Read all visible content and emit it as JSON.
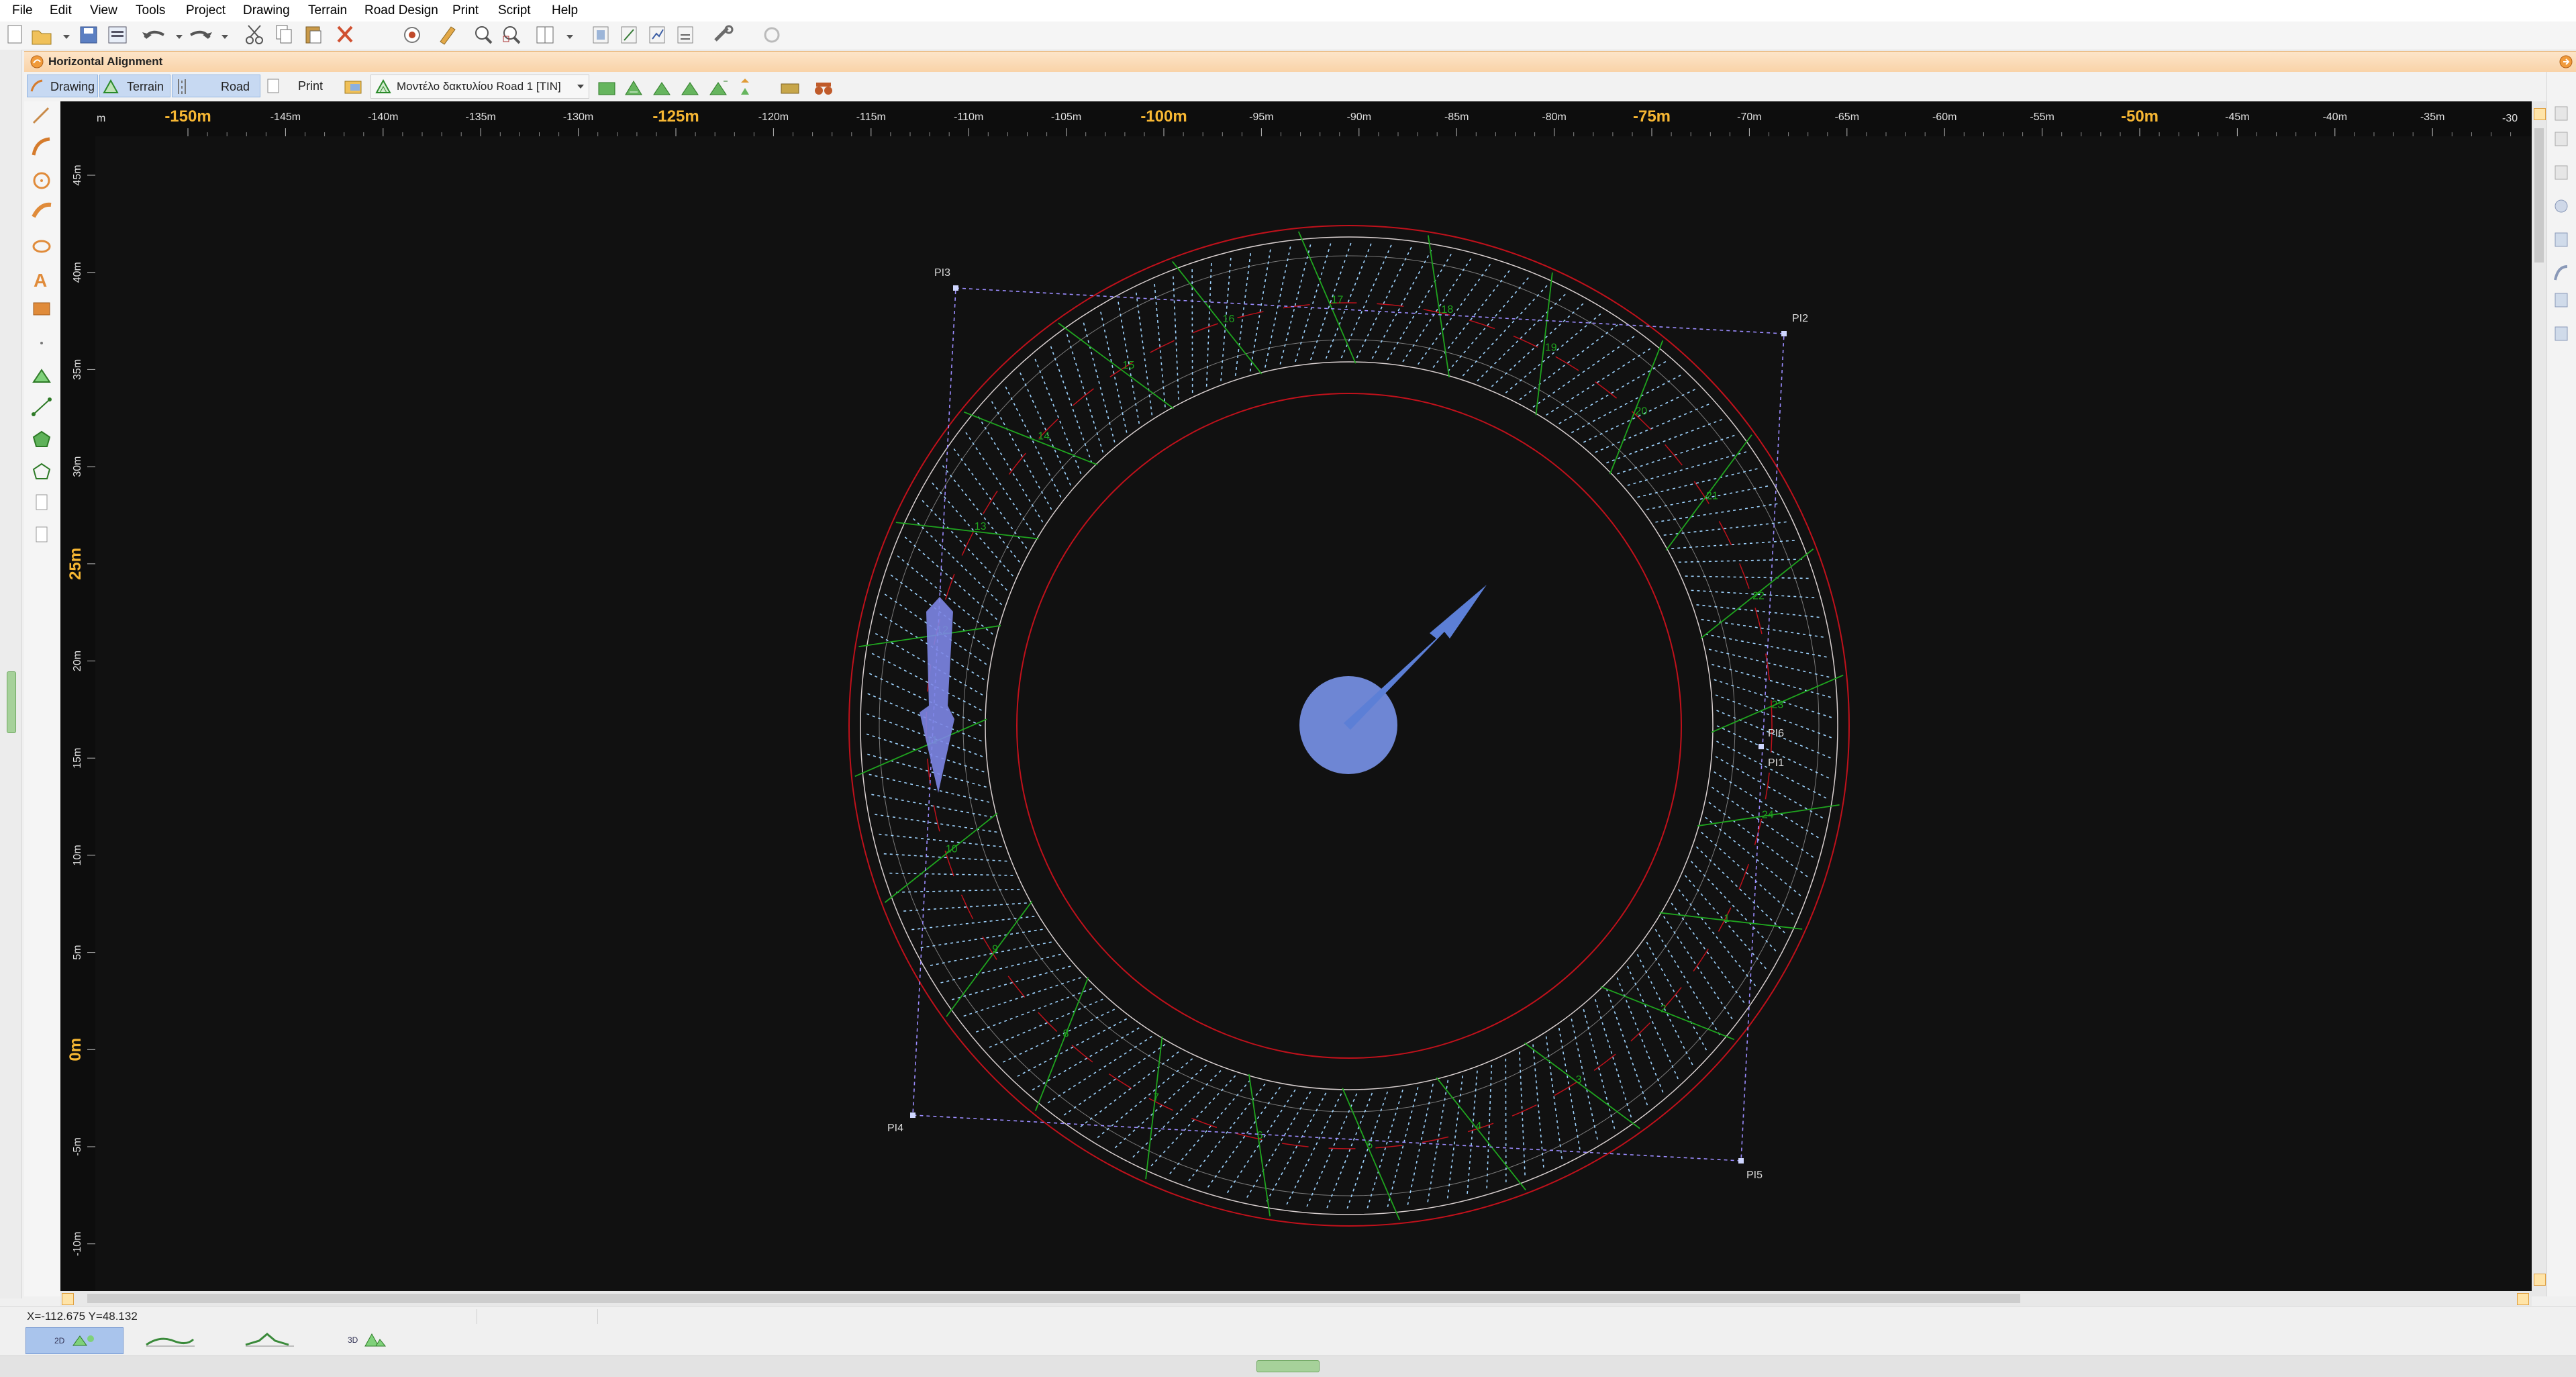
{
  "menu": {
    "items": [
      "File",
      "Edit",
      "View",
      "Tools",
      "Project",
      "Drawing",
      "Terrain",
      "Road Design",
      "Print",
      "Script",
      "Help"
    ]
  },
  "panel": {
    "title": "Horizontal Alignment"
  },
  "view_tabs": {
    "drawing": "Drawing",
    "terrain": "Terrain",
    "road": "Road",
    "print": "Print",
    "model_select": "Μοντέλο δακτυλίου Road 1 [TIN]"
  },
  "ruler": {
    "x_labels": [
      {
        "text": "-150m",
        "major": true
      },
      {
        "text": "-145m",
        "major": false
      },
      {
        "text": "-140m",
        "major": false
      },
      {
        "text": "-135m",
        "major": false
      },
      {
        "text": "-130m",
        "major": false
      },
      {
        "text": "-125m",
        "major": true
      },
      {
        "text": "-120m",
        "major": false
      },
      {
        "text": "-115m",
        "major": false
      },
      {
        "text": "-110m",
        "major": false
      },
      {
        "text": "-105m",
        "major": false
      },
      {
        "text": "-100m",
        "major": true
      },
      {
        "text": "-95m",
        "major": false
      },
      {
        "text": "-90m",
        "major": false
      },
      {
        "text": "-85m",
        "major": false
      },
      {
        "text": "-80m",
        "major": false
      },
      {
        "text": "-75m",
        "major": true
      },
      {
        "text": "-70m",
        "major": false
      },
      {
        "text": "-65m",
        "major": false
      },
      {
        "text": "-60m",
        "major": false
      },
      {
        "text": "-55m",
        "major": false
      },
      {
        "text": "-50m",
        "major": true
      },
      {
        "text": "-45m",
        "major": false
      },
      {
        "text": "-40m",
        "major": false
      },
      {
        "text": "-35m",
        "major": false
      }
    ],
    "x_edge_left": "m",
    "x_edge_right": "-30",
    "y_labels": [
      {
        "text": "45m",
        "major": false
      },
      {
        "text": "40m",
        "major": false
      },
      {
        "text": "35m",
        "major": false
      },
      {
        "text": "30m",
        "major": false
      },
      {
        "text": "25m",
        "major": true
      },
      {
        "text": "20m",
        "major": false
      },
      {
        "text": "15m",
        "major": false
      },
      {
        "text": "10m",
        "major": false
      },
      {
        "text": "5m",
        "major": false
      },
      {
        "text": "0m",
        "major": true
      },
      {
        "text": "-5m",
        "major": false
      },
      {
        "text": "-10m",
        "major": false
      }
    ]
  },
  "drawing": {
    "pi_labels": [
      "PI3",
      "PI2",
      "PI4",
      "PI5",
      "PI6",
      "PI1"
    ],
    "station_labels": [
      "12",
      "13",
      "14",
      "15",
      "16",
      "17",
      "18",
      "19",
      "20",
      "21",
      "22",
      "23",
      "24",
      "1",
      "2",
      "3",
      "4",
      "5",
      "6",
      "7",
      "8",
      "9",
      "10",
      "11"
    ],
    "colors": {
      "background": "#111111",
      "ring_outer": "#c0111b",
      "road_edge": "#d9d0d0",
      "dashed_lines": "#9fd4ff",
      "sections": "#1fa51f",
      "polygon": "#9b8cff",
      "arrow": "#7d86e6",
      "center": "#6e86d4"
    }
  },
  "status": {
    "coords": "X=-112.675  Y=48.132"
  },
  "bottom_tabs": [
    "2D",
    "3D"
  ]
}
